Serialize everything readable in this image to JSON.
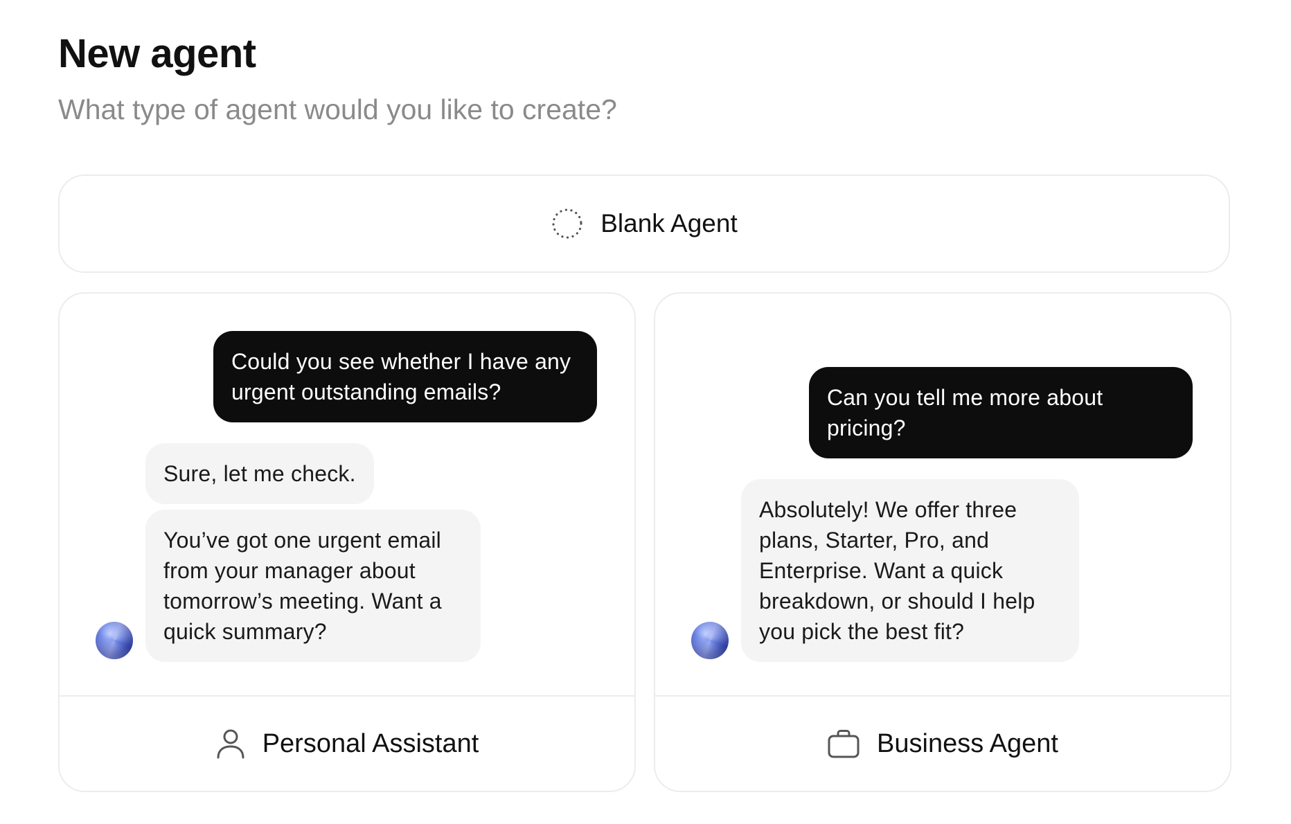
{
  "header": {
    "title": "New agent",
    "subtitle": "What type of agent would you like to create?"
  },
  "blank_agent": {
    "label": "Blank Agent",
    "icon": "dashed-circle-icon"
  },
  "templates": [
    {
      "label": "Personal Assistant",
      "icon": "person-icon",
      "messages": [
        {
          "role": "user",
          "text": "Could you see whether I have any urgent outstanding emails?"
        },
        {
          "role": "agent",
          "text": "Sure, let me check."
        },
        {
          "role": "agent",
          "text": "You’ve got one urgent email from your manager about tomorrow’s meeting. Want a quick summary?"
        }
      ]
    },
    {
      "label": "Business Agent",
      "icon": "briefcase-icon",
      "messages": [
        {
          "role": "user",
          "text": "Can you tell me more about pricing?"
        },
        {
          "role": "agent",
          "text": "Absolutely! We offer three plans, Starter, Pro, and Enterprise. Want a quick breakdown, or should I help you pick the best fit?"
        }
      ]
    }
  ],
  "colors": {
    "user_bubble": "#0d0d0d",
    "agent_bubble": "#f4f4f4",
    "subtitle": "#8a8a8a",
    "border": "#ececec"
  }
}
